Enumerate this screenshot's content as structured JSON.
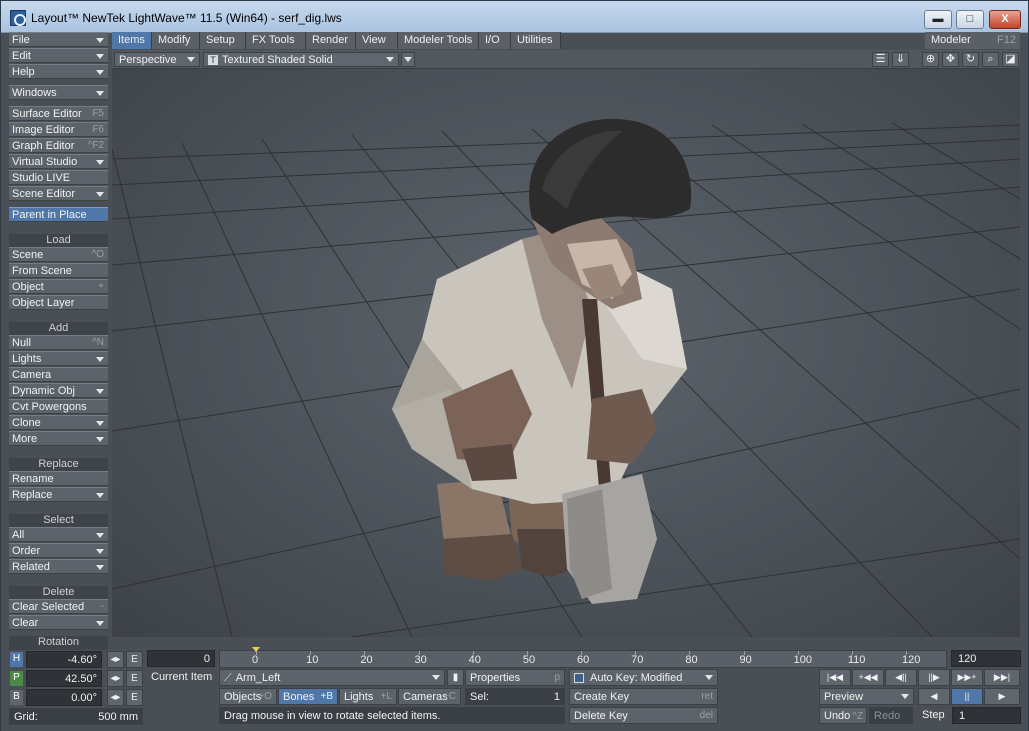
{
  "window": {
    "title": "Layout™ NewTek LightWave™ 11.5 (Win64) - serf_dig.lws",
    "minimize_label": "▬",
    "maximize_label": "□",
    "close_label": "X"
  },
  "sidebar": {
    "menus": [
      {
        "label": "File"
      },
      {
        "label": "Edit"
      },
      {
        "label": "Help"
      },
      {
        "label": "Windows"
      }
    ],
    "editors": [
      {
        "label": "Surface Editor",
        "shortcut": "F5"
      },
      {
        "label": "Image Editor",
        "shortcut": "F6"
      },
      {
        "label": "Graph Editor",
        "shortcut": "^F2"
      },
      {
        "label": "Virtual Studio",
        "shortcut": ""
      },
      {
        "label": "Studio LIVE",
        "shortcut": ""
      },
      {
        "label": "Scene Editor",
        "shortcut": ""
      }
    ],
    "parent_in_place": "Parent in Place",
    "load": {
      "header": "Load",
      "items": [
        {
          "label": "Scene",
          "shortcut": "^O"
        },
        {
          "label": "From Scene",
          "shortcut": ""
        },
        {
          "label": "Object",
          "shortcut": "+"
        },
        {
          "label": "Object Layer",
          "shortcut": ""
        }
      ]
    },
    "add": {
      "header": "Add",
      "items": [
        {
          "label": "Null",
          "shortcut": "^N"
        },
        {
          "label": "Lights",
          "shortcut": ""
        },
        {
          "label": "Camera",
          "shortcut": ""
        },
        {
          "label": "Dynamic Obj",
          "shortcut": ""
        },
        {
          "label": "Cvt Powergons",
          "shortcut": ""
        },
        {
          "label": "Clone",
          "shortcut": ""
        },
        {
          "label": "More",
          "shortcut": ""
        }
      ]
    },
    "replace": {
      "header": "Replace",
      "items": [
        {
          "label": "Rename"
        },
        {
          "label": "Replace"
        }
      ]
    },
    "select": {
      "header": "Select",
      "items": [
        {
          "label": "All"
        },
        {
          "label": "Order"
        },
        {
          "label": "Related"
        }
      ]
    },
    "delete": {
      "header": "Delete",
      "items": [
        {
          "label": "Clear Selected",
          "shortcut": "-"
        },
        {
          "label": "Clear",
          "shortcut": ""
        }
      ]
    }
  },
  "tabs": [
    {
      "label": "Items"
    },
    {
      "label": "Modify"
    },
    {
      "label": "Setup"
    },
    {
      "label": "FX Tools"
    },
    {
      "label": "Render"
    },
    {
      "label": "View"
    },
    {
      "label": "Modeler Tools"
    },
    {
      "label": "I/O"
    },
    {
      "label": "Utilities"
    }
  ],
  "modeler": {
    "label": "Modeler",
    "shortcut": "F12"
  },
  "viewport_bar": {
    "view": "Perspective",
    "render_mode_icon": "T",
    "render_mode": "Textured Shaded Solid"
  },
  "transform": {
    "title": "Rotation",
    "h": {
      "axis": "H",
      "value": "-4.60°"
    },
    "p": {
      "axis": "P",
      "value": "42.50°"
    },
    "b": {
      "axis": "B",
      "value": "0.00°"
    },
    "env": "E",
    "grid_label": "Grid:",
    "grid_value": "500 mm"
  },
  "timeline": {
    "start": "0",
    "end": "120",
    "ticks": [
      "0",
      "10",
      "20",
      "30",
      "40",
      "50",
      "60",
      "70",
      "80",
      "90",
      "100",
      "110",
      "120"
    ],
    "current_frame_fraction": 0
  },
  "current_item": {
    "label": "Current Item",
    "value": "Arm_Left"
  },
  "filters": {
    "objects": "Objects",
    "objects_sc": "+O",
    "bones": "Bones",
    "bones_sc": "+B",
    "lights": "Lights",
    "lights_sc": "+L",
    "cameras": "Cameras",
    "cameras_sc": "+C"
  },
  "properties": {
    "label": "Properties",
    "shortcut": "p"
  },
  "sel": {
    "label": "Sel:",
    "value": "1"
  },
  "autokey": {
    "label": "Auto Key: Modified"
  },
  "create_key": {
    "label": "Create Key",
    "shortcut": "ret"
  },
  "delete_key": {
    "label": "Delete Key",
    "shortcut": "del"
  },
  "playback": {
    "first": "|◀◀",
    "prev_key": "+◀◀",
    "prev_frame": "◀||",
    "next_frame": "||▶",
    "next_key": "▶▶+",
    "last": "▶▶|"
  },
  "preview": "Preview",
  "play_back": "◀",
  "pause": "||",
  "play_fwd": "▶",
  "undo": {
    "label": "Undo",
    "shortcut": "^Z"
  },
  "redo": "Redo",
  "step": {
    "label": "Step",
    "value": "1"
  },
  "status": "Drag mouse in view to rotate selected items."
}
